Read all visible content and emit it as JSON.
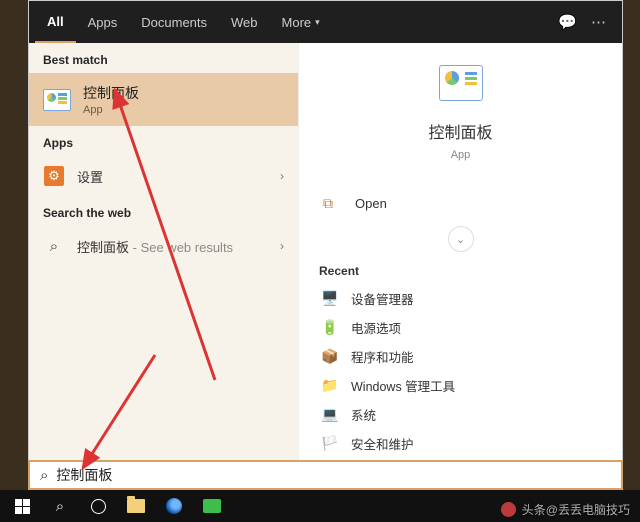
{
  "tabs": {
    "all": "All",
    "apps": "Apps",
    "documents": "Documents",
    "web": "Web",
    "more": "More"
  },
  "groups": {
    "best_match": "Best match",
    "apps": "Apps",
    "search_web": "Search the web"
  },
  "best_match": {
    "title": "控制面板",
    "subtitle": "App"
  },
  "apps_list": {
    "settings": "设置"
  },
  "web_list": {
    "query": "控制面板",
    "suffix": " - See web results"
  },
  "preview": {
    "title": "控制面板",
    "subtitle": "App",
    "open": "Open",
    "recent_header": "Recent",
    "recent": [
      {
        "icon": "🖥️",
        "label": "设备管理器"
      },
      {
        "icon": "🔋",
        "label": "电源选项"
      },
      {
        "icon": "📦",
        "label": "程序和功能"
      },
      {
        "icon": "📁",
        "label": "Windows 管理工具"
      },
      {
        "icon": "💻",
        "label": "系统"
      },
      {
        "icon": "🏳️",
        "label": "安全和维护"
      }
    ]
  },
  "search_value": "控制面板",
  "watermark": {
    "prefix": "头条@",
    "name": "丢丢电脑技巧"
  }
}
